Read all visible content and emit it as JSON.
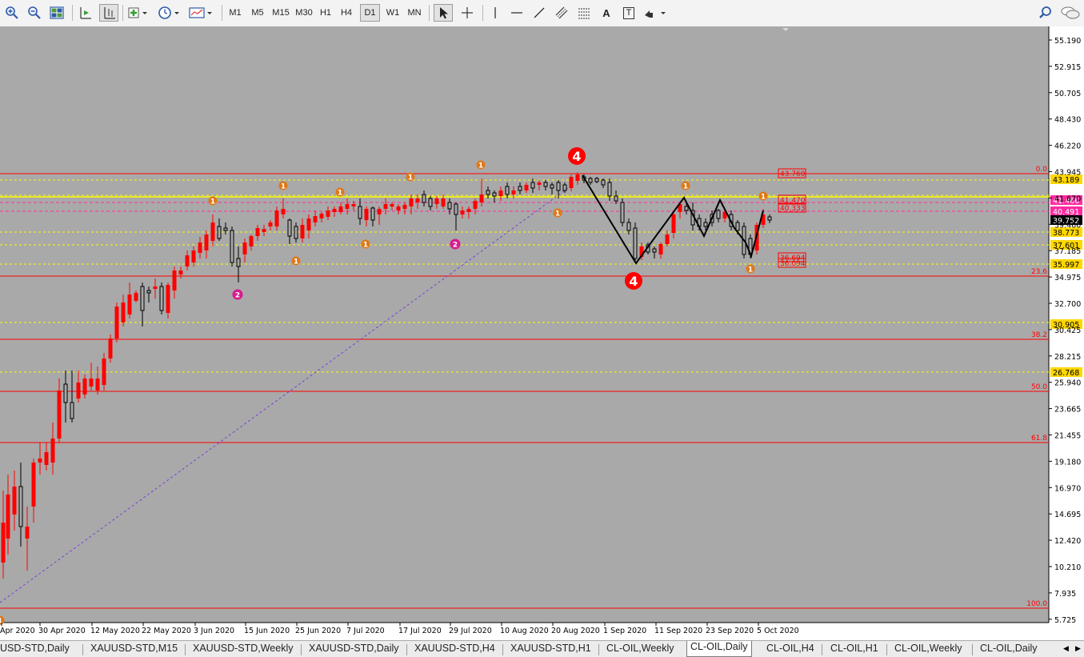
{
  "toolbar": {
    "timeframes": [
      "M1",
      "M5",
      "M15",
      "M30",
      "H1",
      "H4",
      "D1",
      "W1",
      "MN"
    ],
    "active_timeframe": "D1",
    "text_tool": "A",
    "label_tool": "T"
  },
  "chart": {
    "price_axis": [
      "55.190",
      "52.915",
      "50.705",
      "48.430",
      "46.220",
      "43.945",
      "41.670",
      "39.460",
      "37.185",
      "34.975",
      "32.700",
      "30.425",
      "28.215",
      "25.940",
      "23.665",
      "21.455",
      "19.180",
      "16.970",
      "14.695",
      "12.420",
      "10.210",
      "7.935",
      "5.725"
    ],
    "time_axis": [
      "Apr 2020",
      "30 Apr 2020",
      "12 May 2020",
      "22 May 2020",
      "3 Jun 2020",
      "15 Jun 2020",
      "25 Jun 2020",
      "7 Jul 2020",
      "17 Jul 2020",
      "29 Jul 2020",
      "10 Aug 2020",
      "20 Aug 2020",
      "1 Sep 2020",
      "11 Sep 2020",
      "23 Sep 2020",
      "5 Oct 2020"
    ],
    "fib_levels": [
      "0.0",
      "23.6",
      "38.2",
      "50.0",
      "61.8",
      "100.0"
    ],
    "current_price": "39.752",
    "price_tags": [
      {
        "value": "43.189",
        "style": "yellow"
      },
      {
        "value": "41.466",
        "style": "magenta"
      },
      {
        "value": "40.491",
        "style": "magenta"
      },
      {
        "value": "38.773",
        "style": "yellow"
      },
      {
        "value": "37.601",
        "style": "yellow"
      },
      {
        "value": "35.997",
        "style": "yellow"
      },
      {
        "value": "30.905",
        "style": "yellow"
      },
      {
        "value": "26.768",
        "style": "yellow"
      }
    ],
    "chart_labels": [
      {
        "value": "43.760",
        "style": "red-box"
      },
      {
        "value": "41.470",
        "style": "red-box"
      },
      {
        "value": "40.333",
        "style": "red-box"
      },
      {
        "value": "36.694",
        "style": "red-box"
      },
      {
        "value": "36.094",
        "style": "red-box"
      }
    ],
    "wave_markers": [
      "1",
      "1",
      "1",
      "1",
      "1",
      "2",
      "1",
      "1",
      "2",
      "1",
      "1",
      "1",
      "1",
      "1"
    ],
    "big_markers": [
      "4",
      "4"
    ]
  },
  "tabs": {
    "items": [
      "USD-STD,Daily",
      "XAUUSD-STD,M15",
      "XAUUSD-STD,Weekly",
      "XAUUSD-STD,Daily",
      "XAUUSD-STD,H4",
      "XAUUSD-STD,H1",
      "CL-OIL,Weekly",
      "CL-OIL,Daily",
      "CL-OIL,H4",
      "CL-OIL,H1",
      "CL-OIL,Weekly",
      "CL-OIL,Daily"
    ],
    "active_index": 7
  },
  "colors": {
    "chart_bg": "#a9a9a9",
    "bull": "#000000",
    "bear": "#ff0000",
    "fib_line": "#ff0000",
    "level_line": "#ffff00",
    "marker_orange": "#e07818",
    "marker_magenta": "#d81b8c"
  }
}
